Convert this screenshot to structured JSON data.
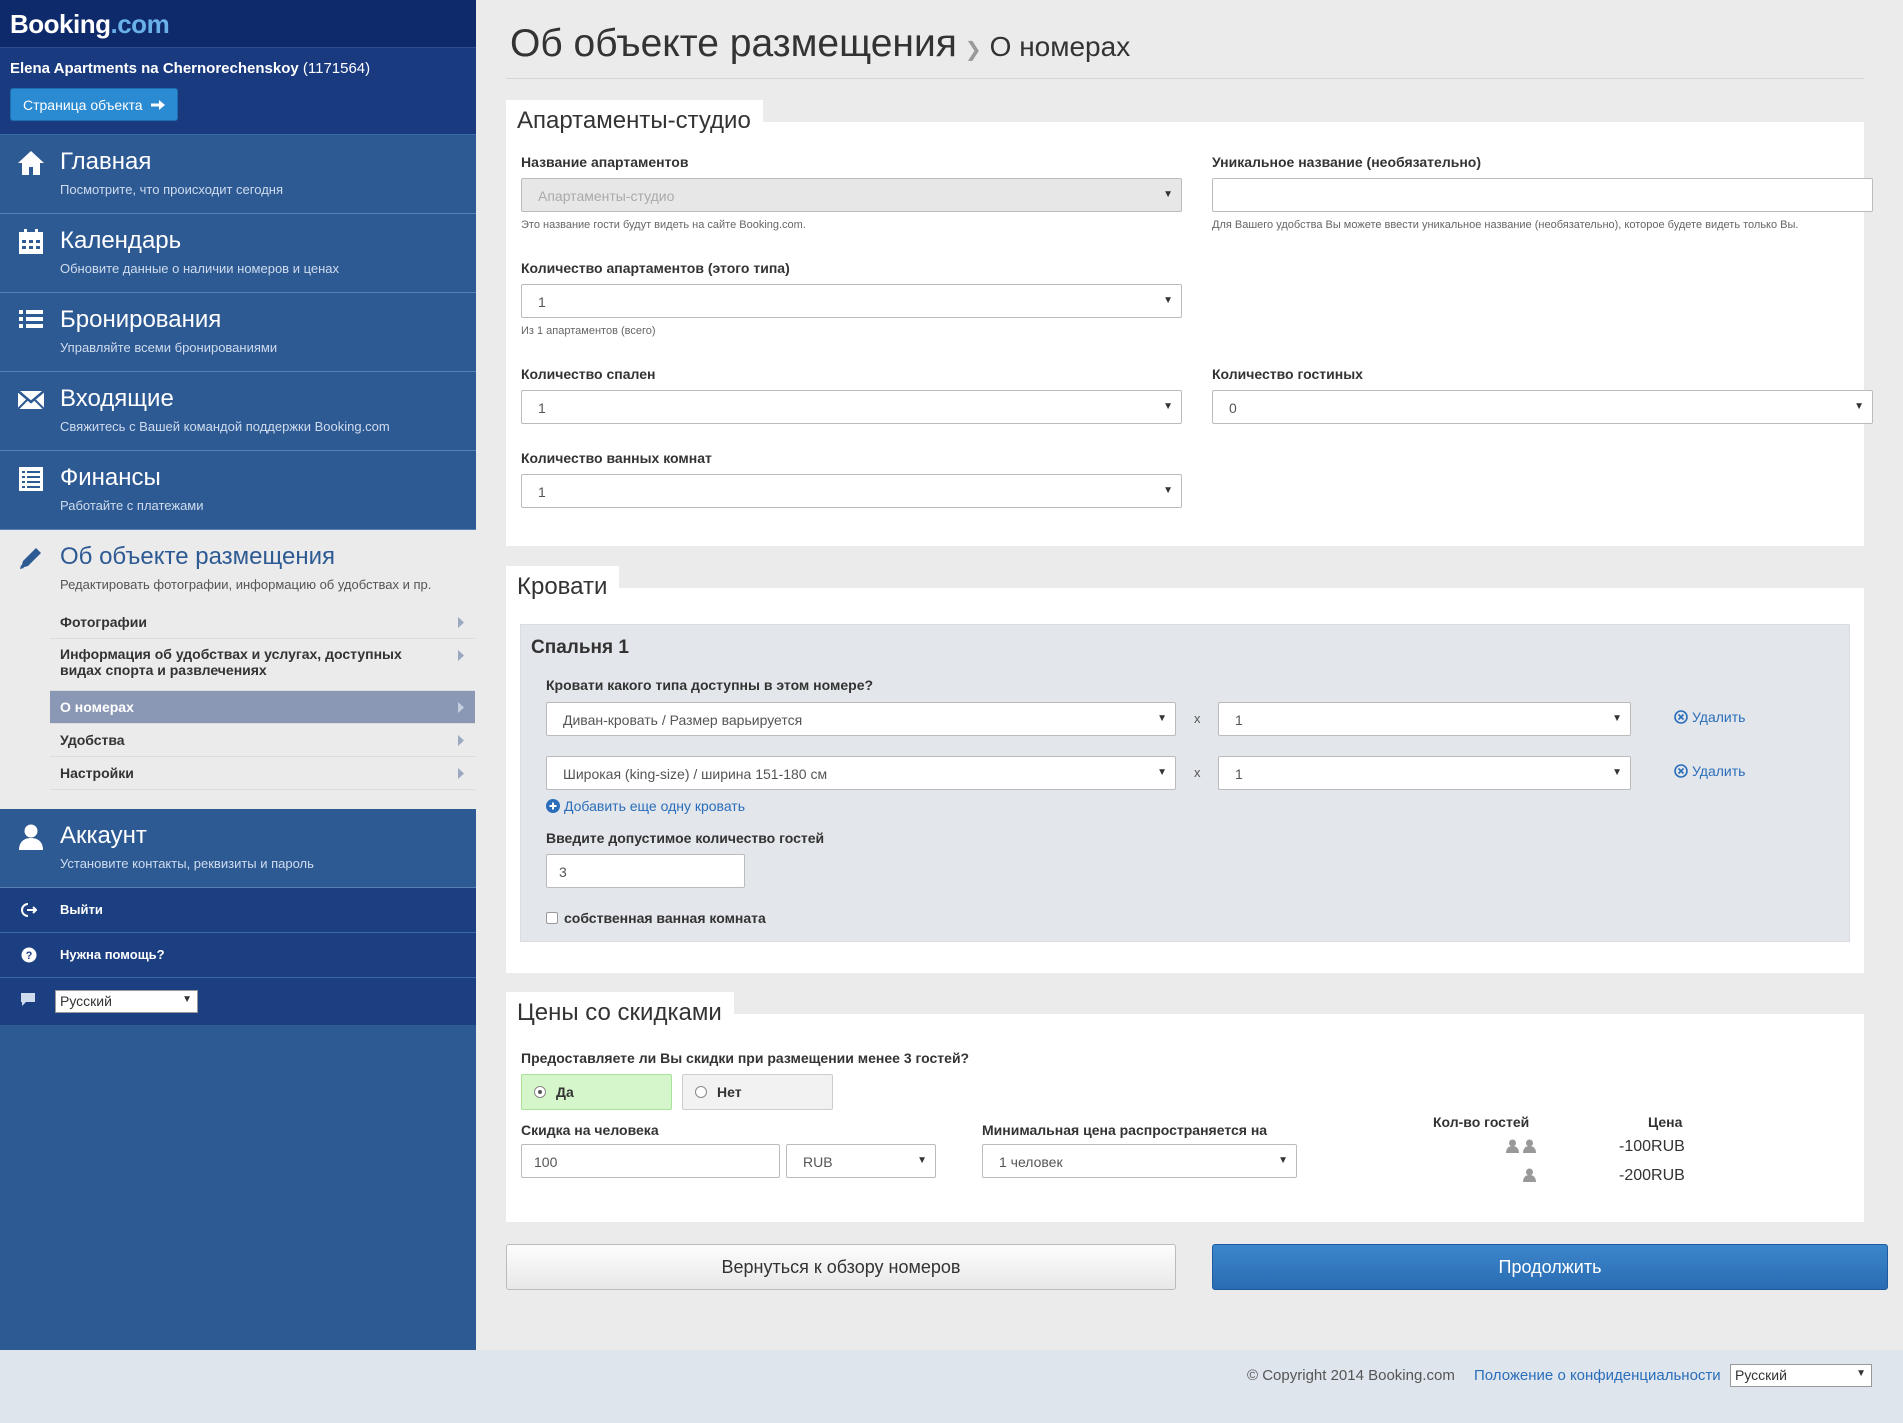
{
  "brand": {
    "name_main": "Booking",
    "name_suffix": ".com"
  },
  "property": {
    "name": "Elena Apartments na Chernorechenskoy",
    "id": "(1171564)",
    "page_button": "Страница объекта"
  },
  "nav": [
    {
      "title": "Главная",
      "sub": "Посмотрите, что происходит сегодня"
    },
    {
      "title": "Календарь",
      "sub": "Обновите данные о наличии номеров и ценах"
    },
    {
      "title": "Бронирования",
      "sub": "Управляйте всеми бронированиями"
    },
    {
      "title": "Входящие",
      "sub": "Свяжитесь с Вашей командой поддержки Booking.com"
    },
    {
      "title": "Финансы",
      "sub": "Работайте с платежами"
    },
    {
      "title": "Об объекте размещения",
      "sub": "Редактировать фотографии, информацию об удобствах и пр."
    },
    {
      "title": "Аккаунт",
      "sub": "Установите контакты, реквизиты и пароль"
    }
  ],
  "subnav": [
    {
      "label": "Фотографии"
    },
    {
      "label": "Информация об удобствах и услугах, доступных видах спорта и развлечениях"
    },
    {
      "label": "О номерах"
    },
    {
      "label": "Удобства"
    },
    {
      "label": "Настройки"
    }
  ],
  "util": {
    "logout": "Выйти",
    "help": "Нужна помощь?",
    "language": "Русский"
  },
  "page": {
    "title": "Об объекте размещения",
    "crumb": "О номерах"
  },
  "room": {
    "tab": "Апартаменты-студио",
    "name_label": "Название апартаментов",
    "name_value": "Апартаменты-студио",
    "name_help": "Это название гости будут видеть на сайте Booking.com.",
    "unique_label": "Уникальное название (необязательно)",
    "unique_value": "",
    "unique_help": "Для Вашего удобства Вы можете ввести уникальное название (необязательно), которое будете видеть только Вы.",
    "count_label": "Количество апартаментов (этого типа)",
    "count_value": "1",
    "count_help": "Из 1 апартаментов (всего)",
    "bedrooms_label": "Количество спален",
    "bedrooms_value": "1",
    "living_label": "Количество гостиных",
    "living_value": "0",
    "bathrooms_label": "Количество ванных комнат",
    "bathrooms_value": "1"
  },
  "beds": {
    "tab": "Кровати",
    "bedroom_title": "Спальня 1",
    "question": "Кровати какого типа доступны в этом номере?",
    "rows": [
      {
        "type": "Диван-кровать  /  Размер варьируется",
        "qty": "1"
      },
      {
        "type": "Широкая (king-size)  /  ширина 151-180 см",
        "qty": "1"
      }
    ],
    "times": "x",
    "remove_label": "Удалить",
    "add_label": "Добавить еще одну кровать",
    "guests_label": "Введите допустимое количество гостей",
    "guests_value": "3",
    "private_bath": "собственная ванная комната"
  },
  "discount": {
    "tab": "Цены со скидками",
    "question": "Предоставляете ли Вы скидки при размещении менее 3 гостей?",
    "yes": "Да",
    "no": "Нет",
    "selected": "yes",
    "per_person_label": "Скидка на человека",
    "per_person_value": "100",
    "currency": "RUB",
    "min_price_label": "Минимальная цена распространяется на",
    "min_price_value": "1 человек",
    "table_head_guests": "Кол-во гостей",
    "table_head_price": "Цена",
    "table_rows": [
      {
        "guests": 2,
        "price": "-100RUB"
      },
      {
        "guests": 1,
        "price": "-200RUB"
      }
    ]
  },
  "actions": {
    "back": "Вернуться к обзору номеров",
    "continue": "Продолжить"
  },
  "footer": {
    "copyright": "© Copyright 2014 Booking.com",
    "privacy": "Положение о конфиденциальности",
    "language": "Русский"
  },
  "colors": {
    "sidebar": "#2e5a94",
    "header": "#0f2a6b",
    "primary_button": "#2a6cb3",
    "selected_radio": "#d5f5cb"
  }
}
